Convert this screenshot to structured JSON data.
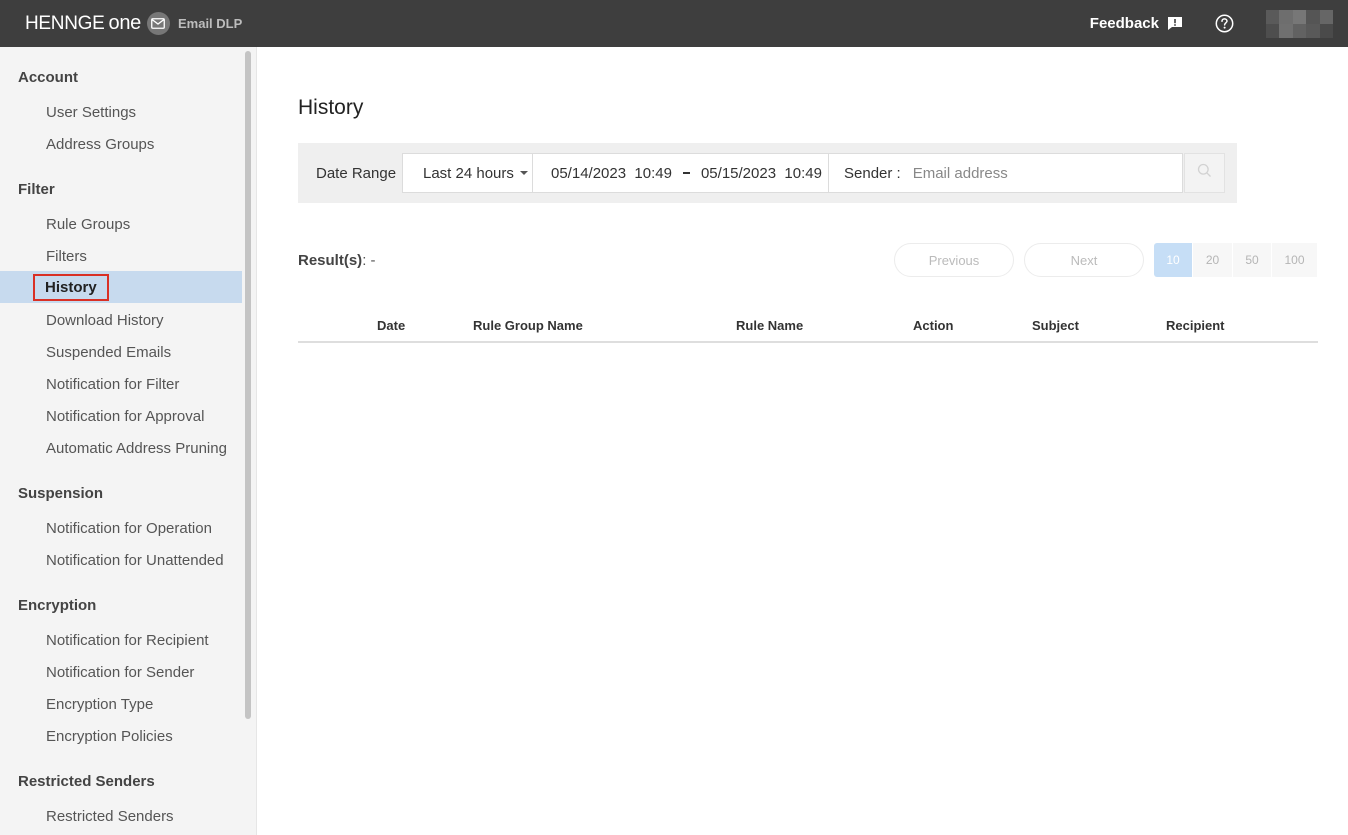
{
  "header": {
    "brand_name": "HENNGE One",
    "brand_word1": "HENNGE",
    "brand_word2": "one",
    "product": "Email DLP",
    "feedback_label": "Feedback",
    "icons": {
      "mail": "mail-icon",
      "feedback": "feedback-icon",
      "help": "help-icon"
    }
  },
  "sidebar": {
    "sections": [
      {
        "title": "Account",
        "items": [
          "User Settings",
          "Address Groups"
        ]
      },
      {
        "title": "Filter",
        "items": [
          "Rule Groups",
          "Filters",
          "History",
          "Download History",
          "Suspended Emails",
          "Notification for Filter",
          "Notification for Approval",
          "Automatic Address Pruning"
        ]
      },
      {
        "title": "Suspension",
        "items": [
          "Notification for Operation",
          "Notification for Unattended"
        ]
      },
      {
        "title": "Encryption",
        "items": [
          "Notification for Recipient",
          "Notification for Sender",
          "Encryption Type",
          "Encryption Policies"
        ]
      },
      {
        "title": "Restricted Senders",
        "items": [
          "Restricted Senders"
        ]
      }
    ],
    "active_item": "History",
    "active_color": "#c7daee",
    "highlight_color": "#d93025"
  },
  "main": {
    "title": "History",
    "filter": {
      "date_range_label": "Date Range",
      "range_value": "Last 24 hours",
      "start_date": "05/14/2023",
      "start_time": "10:49",
      "end_date": "05/15/2023",
      "end_time": "10:49",
      "sender_label": "Sender :",
      "sender_placeholder": "Email address",
      "sender_value": ""
    },
    "results_label": "Result(s)",
    "results_value": ": -",
    "pagination": {
      "previous": "Previous",
      "next": "Next",
      "sizes": [
        "10",
        "20",
        "50",
        "100"
      ],
      "selected_size": "10"
    },
    "table": {
      "columns": [
        "Date",
        "Rule Group Name",
        "Rule Name",
        "Action",
        "Subject",
        "Recipient"
      ],
      "rows": []
    }
  }
}
